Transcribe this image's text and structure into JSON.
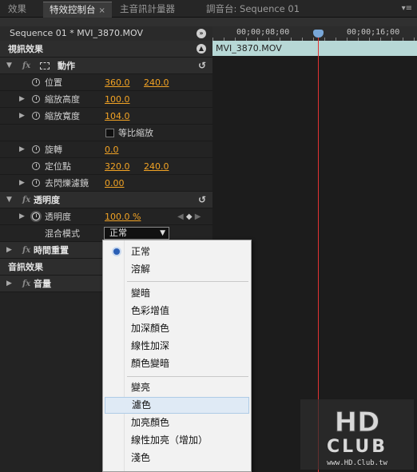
{
  "tabs": [
    {
      "label": "效果",
      "active": false
    },
    {
      "label": "特效控制台",
      "active": true
    },
    {
      "label": "主音訊計量器",
      "active": false
    },
    {
      "label": "調音台: Sequence 01",
      "active": false
    }
  ],
  "tab_close": "×",
  "panel_header": "Sequence 01 * MVI_3870.MOV",
  "timeline": {
    "ticks": [
      "00;00;08;00",
      "00;00;16;00"
    ],
    "clip": "MVI_3870.MOV",
    "playhead_color": "#e03333",
    "clip_color": "#b7d8d6"
  },
  "video_effects": {
    "header": "視訊效果",
    "motion": {
      "name": "動作",
      "position": {
        "label": "位置",
        "x": "360.0",
        "y": "240.0"
      },
      "scale_height": {
        "label": "縮放高度",
        "value": "100.0"
      },
      "scale_width": {
        "label": "縮放寬度",
        "value": "104.0"
      },
      "uniform_scale": {
        "label": "等比縮放"
      },
      "rotation": {
        "label": "旋轉",
        "value": "0.0"
      },
      "anchor": {
        "label": "定位點",
        "x": "320.0",
        "y": "240.0"
      },
      "antiflicker": {
        "label": "去閃爍濾鏡",
        "value": "0.00"
      }
    },
    "opacity": {
      "name": "透明度",
      "opacity": {
        "label": "透明度",
        "value": "100.0 %"
      },
      "blend": {
        "label": "混合模式",
        "value": "正常"
      }
    },
    "time_remap": {
      "name": "時間重置"
    }
  },
  "audio_effects": {
    "header": "音訊效果",
    "volume": {
      "name": "音量"
    }
  },
  "blend_menu": {
    "group1": [
      "正常",
      "溶解"
    ],
    "group2": [
      "變暗",
      "色彩增值",
      "加深顏色",
      "線性加深",
      "顏色變暗"
    ],
    "group3": [
      "變亮",
      "濾色",
      "加亮顏色",
      "線性加亮（增加）",
      "淺色"
    ],
    "selected": "正常",
    "highlighted": "濾色"
  },
  "watermark": {
    "logo": "HD CLUB",
    "url": "www.HD.Club.tw"
  },
  "colors": {
    "value_orange": "#f2a324",
    "accent_blue": "#2b5fb5"
  }
}
